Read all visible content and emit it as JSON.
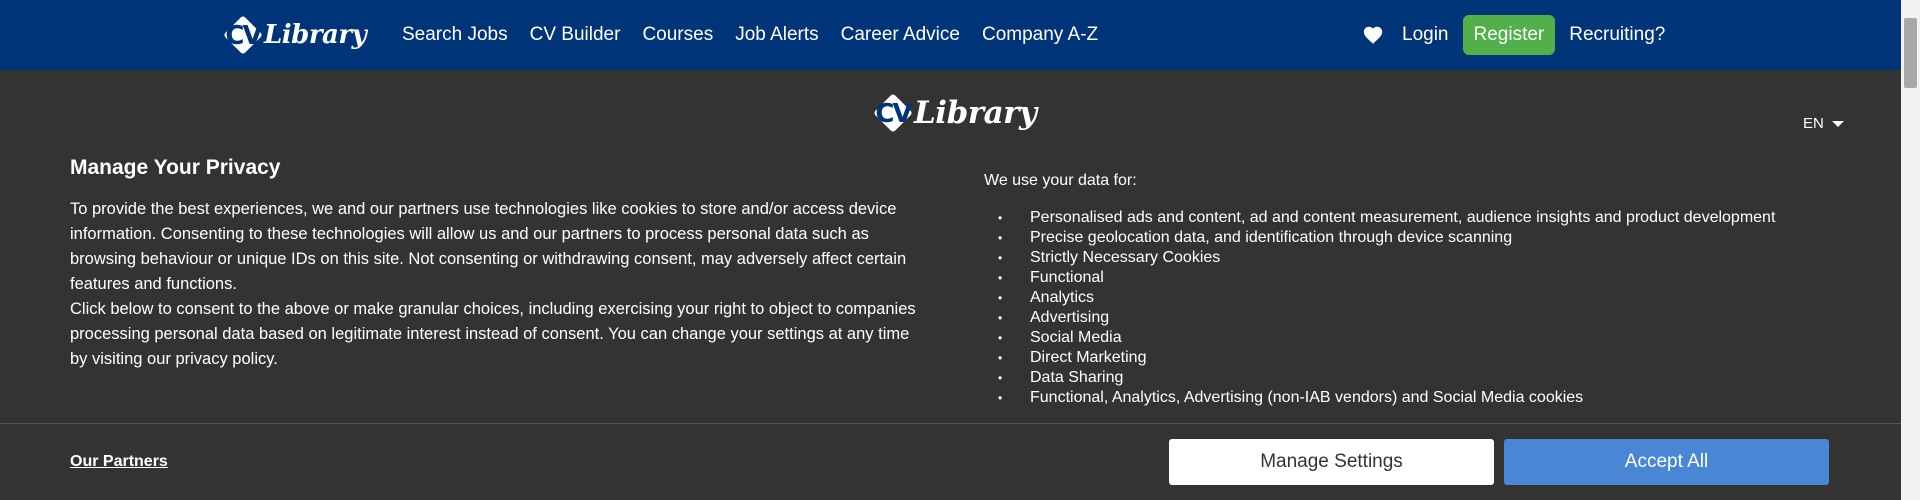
{
  "header": {
    "logo_cv": "CV",
    "logo_text": "Library",
    "nav": [
      "Search Jobs",
      "CV Builder",
      "Courses",
      "Job Alerts",
      "Career Advice",
      "Company A-Z"
    ],
    "login": "Login",
    "register": "Register",
    "recruiting": "Recruiting?"
  },
  "modal": {
    "logo_cv": "CV",
    "logo_text": "Library",
    "language": "EN",
    "title": "Manage Your Privacy",
    "paragraph1": "To provide the best experiences, we and our partners use technologies like cookies to store and/or access device information. Consenting to these technologies will allow us and our partners to process personal data such as browsing behaviour or unique IDs on this site. Not consenting or withdrawing consent, may adversely affect certain features and functions.",
    "paragraph2": "Click below to consent to the above or make granular choices, including exercising your right to object to companies processing personal data based on legitimate interest instead of consent. You can change your settings at any time by visiting our privacy policy.",
    "uses_intro": "We use your data for:",
    "uses": [
      "Personalised ads and content, ad and content measurement, audience insights and product development",
      "Precise geolocation data, and identification through device scanning",
      "Strictly Necessary Cookies",
      "Functional",
      "Analytics",
      "Advertising",
      "Social Media",
      "Direct Marketing",
      "Data Sharing",
      "Functional, Analytics, Advertising (non-IAB vendors) and Social Media cookies"
    ],
    "partners_link": "Our Partners",
    "manage_settings": "Manage Settings",
    "accept_all": "Accept All"
  },
  "colors": {
    "header_bg": "#003478",
    "modal_bg": "#333333",
    "register_bg": "#52b04a",
    "accept_bg": "#4a86d6"
  },
  "icons": {
    "heart": "heart-icon",
    "language_caret": "caret-down-icon"
  }
}
